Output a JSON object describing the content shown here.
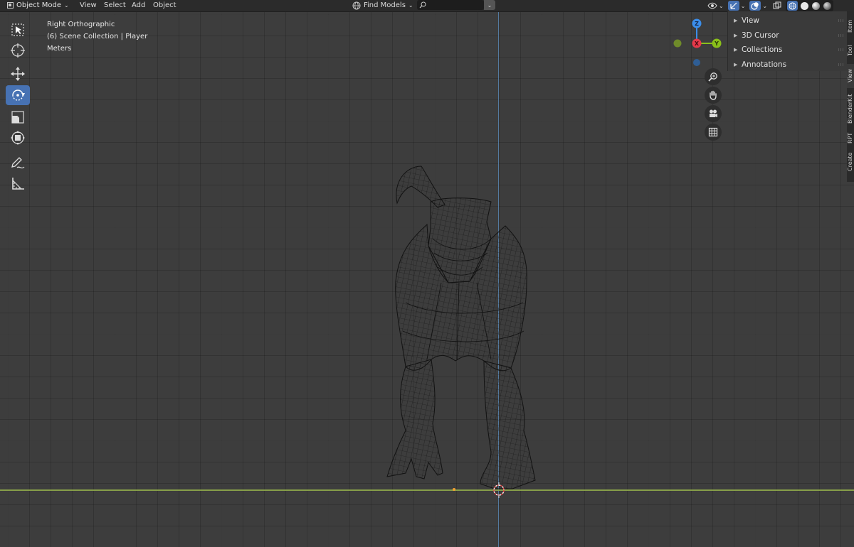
{
  "header": {
    "mode_label": "Object Mode",
    "menus": [
      "View",
      "Select",
      "Add",
      "Object"
    ],
    "find_models_label": "Find Models",
    "search_placeholder": ""
  },
  "overlay": {
    "view_name": "Right Orthographic",
    "collection": "(6) Scene Collection | Player",
    "units": "Meters"
  },
  "gizmo": {
    "z_label": "Z",
    "x_label": "X",
    "y_label": "Y",
    "colors": {
      "x": "#e6394a",
      "y": "#8ac01a",
      "z": "#3b8eea",
      "neg_y": "#6f8b2a",
      "neg_z": "#2f5e95"
    }
  },
  "npanel": {
    "items": [
      "View",
      "3D Cursor",
      "Collections",
      "Annotations"
    ],
    "tabs": [
      "Item",
      "Tool",
      "View",
      "BlenderKit",
      "RPT",
      "Create"
    ]
  },
  "toolbar": {
    "tools": [
      "select-box",
      "cursor",
      "move",
      "rotate",
      "scale",
      "transform",
      "annotate",
      "measure"
    ],
    "active_tool": "rotate"
  },
  "colors": {
    "accent": "#4772b3",
    "background": "#3d3d3d",
    "header": "#2b2b2b"
  }
}
